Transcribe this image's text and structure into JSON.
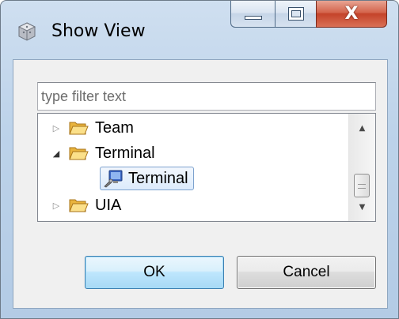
{
  "window": {
    "title": "Show View",
    "close_label": "X"
  },
  "filter": {
    "placeholder": "type filter text",
    "value": ""
  },
  "tree": {
    "items": [
      {
        "label": "Team",
        "expanded": false,
        "icon": "folder-icon",
        "level": 0
      },
      {
        "label": "Terminal",
        "expanded": true,
        "icon": "folder-icon",
        "level": 0
      },
      {
        "label": "Terminal",
        "selected": true,
        "icon": "terminal-view-icon",
        "level": 1
      },
      {
        "label": "UIA",
        "expanded": false,
        "icon": "folder-icon",
        "level": 0
      }
    ]
  },
  "buttons": {
    "ok_label": "OK",
    "cancel_label": "Cancel"
  },
  "colors": {
    "folder": "#f0c04a",
    "selection": "#dcebfc",
    "close_button": "#c4432a"
  }
}
